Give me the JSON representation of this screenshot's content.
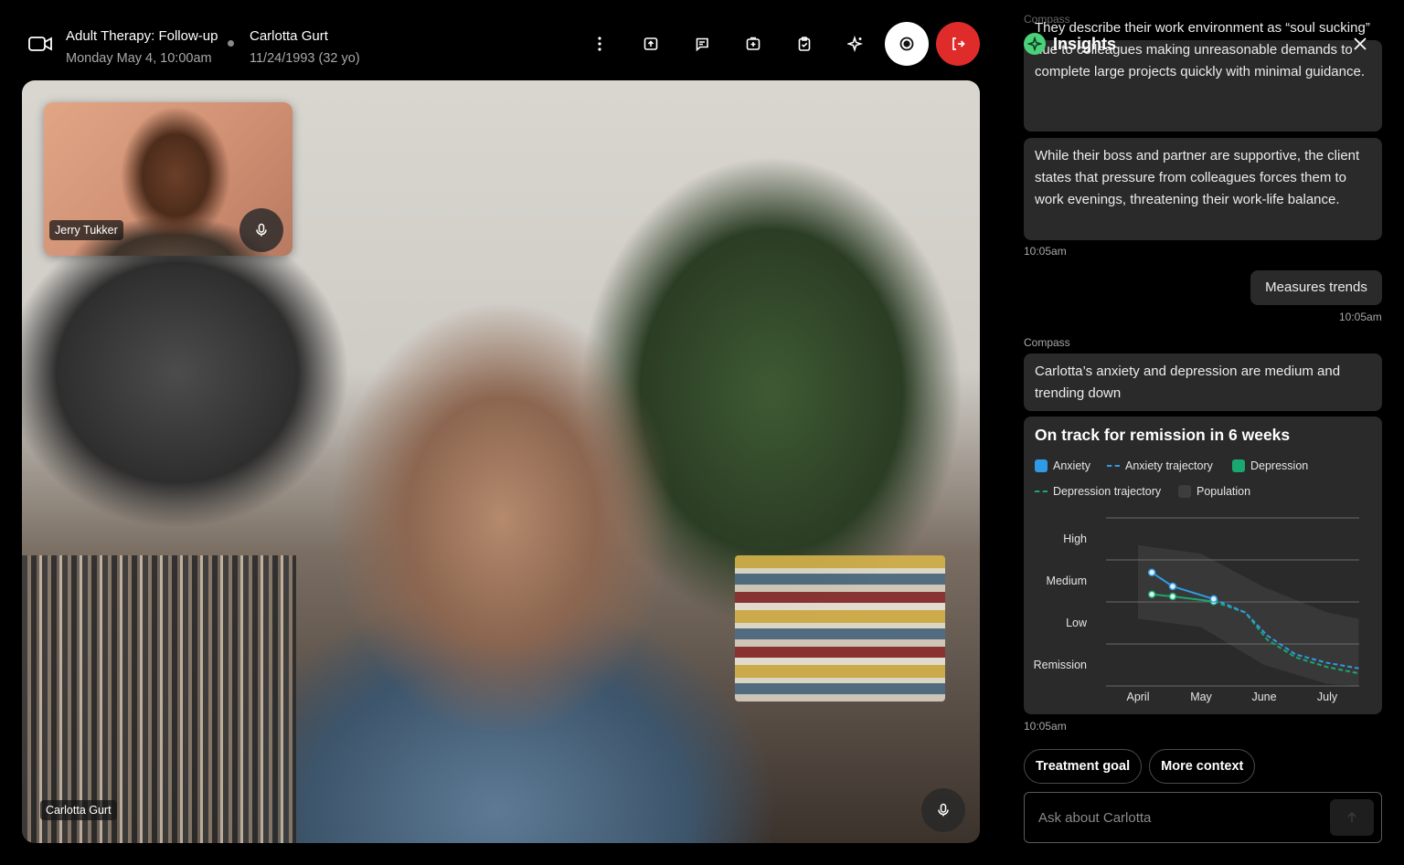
{
  "header": {
    "session_title": "Adult Therapy: Follow-up",
    "session_datetime": "Monday May 4, 10:00am",
    "client_name": "Carlotta Gurt",
    "client_dob": "11/24/1993 (32 yo)"
  },
  "toolbar": {
    "icons": [
      "more-vertical-icon",
      "upload-icon",
      "chat-icon",
      "add-card-icon",
      "clipboard-check-icon",
      "sparkle-icon",
      "record-icon",
      "exit-icon"
    ]
  },
  "video": {
    "main_participant": "Carlotta Gurt",
    "pip_participant": "Jerry Tukker"
  },
  "insights": {
    "title": "Insights",
    "compass_label": "Compass",
    "message1": "They describe their work environment as “soul sucking” due to colleagues making unreasonable demands to complete large projects quickly with minimal guidance.",
    "message2": "While their boss and partner are supportive, the client states that pressure from colleagues forces them to work evenings, threatening their work-life balance.",
    "time1": "10:05am",
    "user_message": "Measures trends",
    "time2": "10:05am",
    "compass_label2": "Compass",
    "message3": "Carlotta’s anxiety and depression are medium and trending down",
    "time3": "10:05am",
    "chips": [
      "Treatment goal",
      "More context"
    ],
    "ask_placeholder": "Ask about Carlotta"
  },
  "chart_data": {
    "type": "line",
    "title": "On track for remission in 6 weeks",
    "legend": [
      "Anxiety",
      "Anxiety trajectory",
      "Depression",
      "Depression trajectory",
      "Population"
    ],
    "y_categories": [
      "Remission",
      "Low",
      "Medium",
      "High"
    ],
    "x_ticks": [
      "April",
      "May",
      "June",
      "July"
    ],
    "colors": {
      "anxiety": "#2f9be6",
      "depression": "#18a870",
      "population": "#3d3d3d"
    },
    "series": [
      {
        "name": "Anxiety",
        "points": [
          [
            0.22,
            2.7
          ],
          [
            0.55,
            2.37
          ],
          [
            1.2,
            2.07
          ]
        ]
      },
      {
        "name": "Depression",
        "points": [
          [
            0.22,
            2.18
          ],
          [
            0.55,
            2.13
          ],
          [
            1.2,
            2.01
          ]
        ]
      },
      {
        "name": "Anxiety trajectory",
        "points": [
          [
            1.2,
            2.07
          ],
          [
            1.7,
            1.75
          ],
          [
            2.05,
            1.2
          ],
          [
            2.5,
            0.75
          ],
          [
            3.0,
            0.55
          ],
          [
            3.5,
            0.42
          ]
        ]
      },
      {
        "name": "Depression trajectory",
        "points": [
          [
            1.2,
            2.01
          ],
          [
            1.7,
            1.75
          ],
          [
            2.05,
            1.1
          ],
          [
            2.5,
            0.68
          ],
          [
            3.0,
            0.45
          ],
          [
            3.5,
            0.3
          ]
        ]
      }
    ],
    "population_band": {
      "upper": [
        [
          0,
          3.35
        ],
        [
          1,
          3.15
        ],
        [
          2,
          2.35
        ],
        [
          3,
          1.75
        ],
        [
          3.5,
          1.6
        ]
      ],
      "lower": [
        [
          0,
          1.6
        ],
        [
          1,
          1.4
        ],
        [
          2,
          0.5
        ],
        [
          3,
          0.05
        ],
        [
          3.5,
          0.0
        ]
      ]
    }
  }
}
